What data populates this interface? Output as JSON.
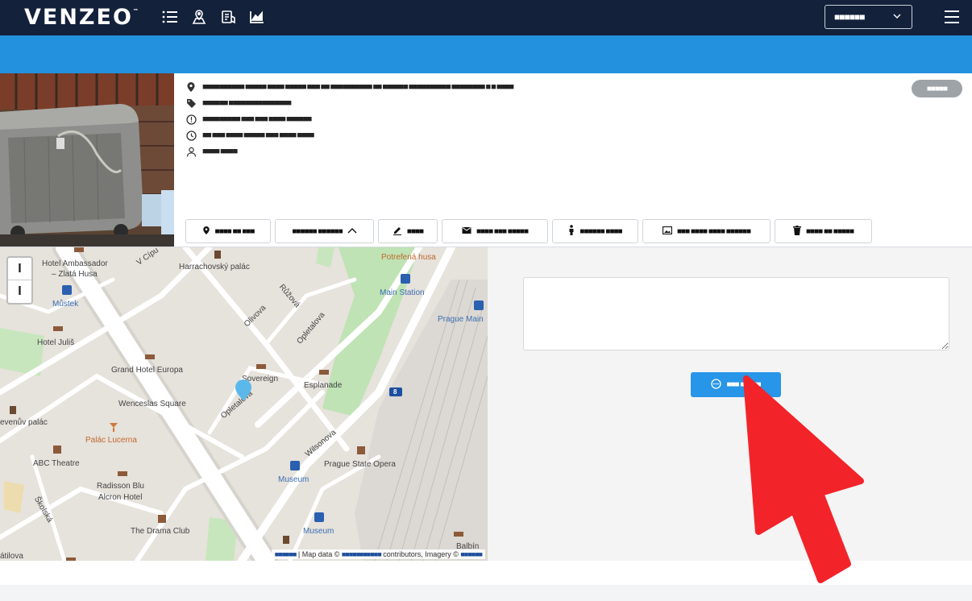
{
  "brand": {
    "name": "VENZEO",
    "tm": "™"
  },
  "header": {
    "language": "■■■■■■",
    "icons": [
      "list-icon",
      "map-pins-icon",
      "report-icon",
      "chart-icon"
    ]
  },
  "report": {
    "address": "■■■■■■■■■■ ■■■■■ ■■■■ ■■■■■ ■■■ ■■ ■■■■■■■■■■ ■■ ■■■■■■ ■■■■■■■■■■ ■■■■■■■■ ■ ■ ■■■■",
    "category": "■■■■■■ ■■■■■■■■■■■■■■■",
    "status": "■■■■■■■■■ ■■■ ■■■ ■■■■ ■■■■■■",
    "time": "■■ ■■■ ■■■■ ■■■■■ ■■■ ■■■■ ■■■■",
    "user": "■■■■ ■■■■",
    "badge": "■■■■■"
  },
  "actions": [
    {
      "label": "■■■■ ■■ ■■■",
      "icon": "location-pin-icon"
    },
    {
      "label": "■■■■■■ ■■■■■■",
      "icon": "chevron-up-icon"
    },
    {
      "label": "■■■■",
      "icon": "pencil-icon"
    },
    {
      "label": "■■■■ ■■■ ■■■■■",
      "icon": "envelope-icon"
    },
    {
      "label": "■■■■■■ ■■■■",
      "icon": "person-icon"
    },
    {
      "label": "■■■ ■■■■ ■■■■ ■■■■■■",
      "icon": "image-icon"
    },
    {
      "label": "■■■■ ■■ ■■■■■",
      "icon": "trash-icon"
    }
  ],
  "map": {
    "zoom_in": "I",
    "zoom_out": "I",
    "attribution_prefix": "■■■■■■",
    "attribution_map": "| Map data ©",
    "attribution_osm": "■■■■■■■■■■■",
    "attribution_contrib": "contributors, Imagery ©",
    "attribution_provider": "■■■■■■",
    "labels": {
      "hotel_ambassador": "Hotel Ambassador",
      "zlata_husa": "– Zlatá Husa",
      "v_cipu": "V Cípu",
      "harrachovsky": "Harrachovský palác",
      "potrefena": "Potrefená husa",
      "mustek": "Můstek",
      "main_station": "Main Station",
      "prague_main": "Prague Main",
      "olivova": "Olivova",
      "ruzova": "Růžová",
      "opletalova1": "Opletalova",
      "hotel_julis": "Hotel Juliš",
      "grand_hotel": "Grand Hotel Europa",
      "sovereign": "Sovereign",
      "esplanade": "Esplanade",
      "wenceslas": "Wenceslas Square",
      "opletalova2": "Opletalova",
      "venuv": "evenův palác",
      "palac_lucerna": "Palác Lucerna",
      "wilsonova": "Wilsonova",
      "abc_theatre": "ABC Theatre",
      "prague_opera": "Prague State Opera",
      "radisson": "Radisson Blu",
      "alcron": "Alcron Hotel",
      "museum1": "Museum",
      "skolska": "Školská",
      "drama_club": "The Drama Club",
      "museum2": "Museum",
      "balbin": "Balbín",
      "atilova": "átilova",
      "route": "8"
    }
  },
  "comment": {
    "placeholder": "",
    "send_label": "■■■ ■■■■■"
  }
}
